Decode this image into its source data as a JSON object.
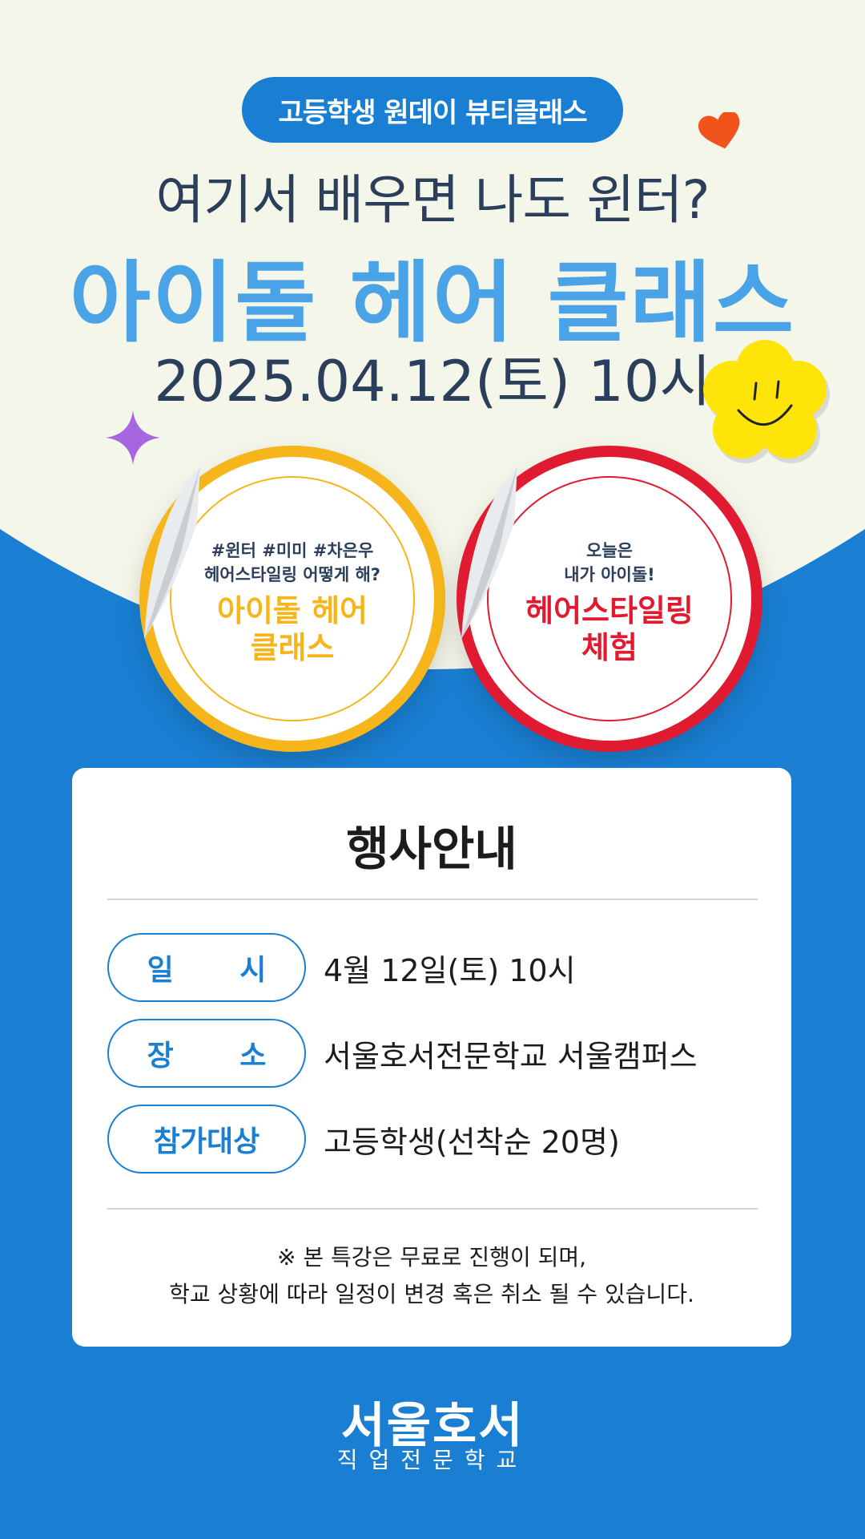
{
  "colors": {
    "blue": "#1a7fd3",
    "cream": "#f5f6ea",
    "yellow": "#f5b51b",
    "red": "#e01a30",
    "light_blue": "#4aa3e6"
  },
  "tag": "고등학생 원데이 뷰티클래스",
  "headline1": "여기서 배우면 나도 윈터?",
  "headline2": "아이돌 헤어 클래스",
  "headline3": "2025.04.12(토) 10시",
  "sticker_left": {
    "line1": "#윈터 #미미 #차은우",
    "line2": "헤어스타일링 어떻게 해?",
    "big1": "아이돌 헤어",
    "big2": "클래스"
  },
  "sticker_right": {
    "line1": "오늘은",
    "line2": "내가 아이돌!",
    "big1": "헤어스타일링",
    "big2": "체험"
  },
  "info": {
    "title": "행사안내",
    "rows": [
      {
        "label": "일 시",
        "value": "4월 12일(토) 10시"
      },
      {
        "label": "장 소",
        "value": "서울호서전문학교 서울캠퍼스"
      },
      {
        "label": "참가대상",
        "value": "고등학생(선착순 20명)"
      }
    ],
    "note1": "※ 본 특강은 무료로 진행이 되며,",
    "note2": "학교 상황에 따라 일정이 변경 혹은 취소 될 수 있습니다."
  },
  "logo": {
    "name": "서울호서",
    "sub": "직업전문학교"
  },
  "icons": [
    "heart-icon",
    "sparkle-icon",
    "smiley-flower-icon"
  ]
}
